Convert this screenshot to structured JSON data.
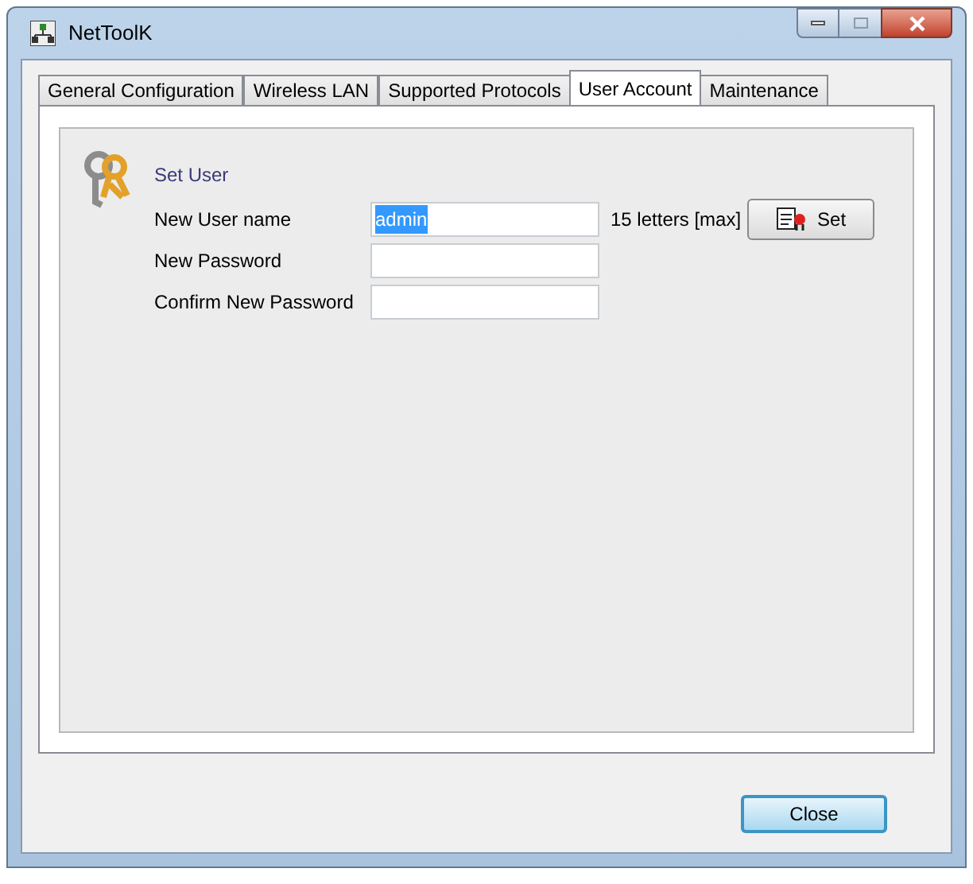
{
  "window": {
    "title": "NetToolK"
  },
  "tabs": [
    {
      "label": "General Configuration",
      "selected": false
    },
    {
      "label": "Wireless LAN",
      "selected": false
    },
    {
      "label": "Supported Protocols",
      "selected": false
    },
    {
      "label": "User Account",
      "selected": true
    },
    {
      "label": "Maintenance",
      "selected": false
    }
  ],
  "section": {
    "title": "Set User"
  },
  "fields": [
    {
      "label": "New User name",
      "value": "admin",
      "text_selected": true,
      "hint": "15 letters [max]",
      "button": "Set"
    },
    {
      "label": "New Password"
    },
    {
      "label": "Confirm New Password"
    }
  ],
  "buttons": [
    "Close"
  ]
}
